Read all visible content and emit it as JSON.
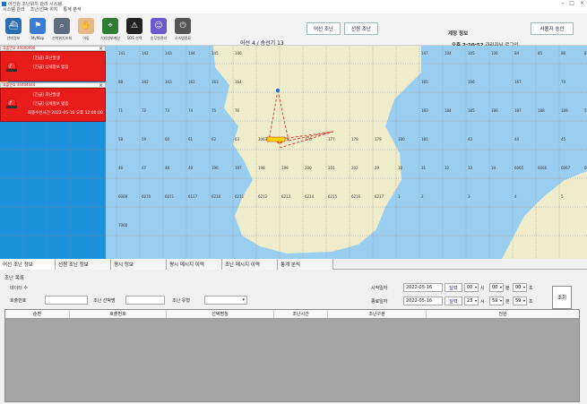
{
  "window": {
    "title": "어선원 조난위치 관리 시스템"
  },
  "menu": [
    "시스템 관리",
    "조난/선박 위치",
    "통계 분석"
  ],
  "toolbar": {
    "tools": [
      {
        "label": "선박정보",
        "icon": "ship-info-icon",
        "color": "#2b6cb0",
        "glyph": "⛴"
      },
      {
        "label": "MyMap",
        "icon": "map-pin-icon",
        "color": "#3a7bd5",
        "glyph": "⚑"
      },
      {
        "label": "선박위치조회",
        "icon": "magnifier-icon",
        "color": "#5d6d7e",
        "glyph": "⌕"
      },
      {
        "label": "이동",
        "icon": "hand-icon",
        "color": "#e6b98a",
        "glyph": "✋"
      },
      {
        "label": "거리방위계산",
        "icon": "compass-icon",
        "color": "#2e7d32",
        "glyph": "⌖"
      },
      {
        "label": "SOS 선택",
        "icon": "sos-icon",
        "color": "#222222",
        "glyph": "⚠"
      },
      {
        "label": "승무원관리",
        "icon": "crew-icon",
        "color": "#6a5acd",
        "glyph": "☺"
      },
      {
        "label": "시스템종료",
        "icon": "power-icon",
        "color": "#555555",
        "glyph": "⏻"
      }
    ],
    "status": "어선 4 / 승선기 13",
    "btn_vessel_distress": "어선 조난",
    "btn_ship_distress": "선원 조난",
    "panel_title": "계정 정보",
    "login_time": "오후 2:10:52",
    "login_text": "관리자님 로그인",
    "btn_user_approve": "사용자 승인"
  },
  "alerts": [
    {
      "header": "호출번호 44000000",
      "line1": "[긴급] 조난발생",
      "line2": "[긴급] 상세정보 없음",
      "line3": ""
    },
    {
      "header": "호출번호 44444444",
      "line1": "[긴급] 조난발생",
      "line2": "[긴급] 상세정보 없음",
      "line3": "최종수신시간 2022-05-16 오후 12:00:00"
    }
  ],
  "map": {
    "grid_labels": [
      "141",
      "142",
      "143",
      "144",
      "145",
      "146",
      "147",
      "104",
      "105",
      "106",
      "84",
      "85",
      "86",
      "87",
      "88",
      "342",
      "343",
      "162",
      "163",
      "164",
      "165",
      "166",
      "167",
      "70",
      "71",
      "72",
      "73",
      "74",
      "75",
      "76",
      "183",
      "184",
      "185",
      "186",
      "187",
      "188",
      "189",
      "57",
      "58",
      "59",
      "60",
      "61",
      "62",
      "63",
      "3063",
      "175",
      "176",
      "177",
      "178",
      "179",
      "180",
      "181",
      "43",
      "44",
      "45",
      "46",
      "47",
      "48",
      "49",
      "196",
      "197",
      "198",
      "199",
      "200",
      "201",
      "202",
      "29",
      "30",
      "31",
      "32",
      "33",
      "34",
      "6065",
      "6066",
      "6067",
      "6068",
      "6069",
      "6070",
      "6071",
      "6117",
      "6210",
      "6211",
      "6212",
      "6213",
      "6214",
      "6215",
      "6216",
      "6217",
      "1",
      "2",
      "3",
      "4",
      "5",
      "7060"
    ]
  },
  "tabs": [
    "어선 조난 정보",
    "선원 조난 정보",
    "평시 정보",
    "평시 메시지 이력",
    "조난 메시지 이력",
    "통계 분석"
  ],
  "search": {
    "title": "조난 목록",
    "count_label": "데이터 수",
    "callsign_label": "호출번호",
    "ship_name_label": "조난 선박명",
    "type_label": "조난 유형",
    "start_label": "시작일자",
    "start_date": "2022-05-16",
    "start_h": "00",
    "start_m": "00",
    "start_s": "00",
    "end_label": "종료일자",
    "end_date": "2022-05-16",
    "end_h": "23",
    "end_m": "59",
    "end_s": "59",
    "cal_label": "달력",
    "hour_label": "시",
    "min_label": "분",
    "sec_label": "초",
    "query_label": "조회"
  },
  "table": {
    "columns": [
      "순번",
      "호출번호",
      "선박명칭",
      "조난시간",
      "조난구분",
      "전원"
    ]
  }
}
